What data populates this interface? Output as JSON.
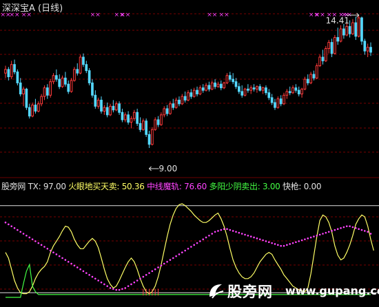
{
  "header": {
    "title": "深深宝A (日线)"
  },
  "indicator_bar": {
    "name": "股旁网",
    "items": [
      {
        "label": "TX: ",
        "value": "97.00",
        "color": "#e0e0e0"
      },
      {
        "label": "火眼地买天卖: ",
        "value": "50.36",
        "color": "#ffff66"
      },
      {
        "label": "中线魔轨: ",
        "value": "76.60",
        "color": "#ff44ff"
      },
      {
        "label": "多阳少阴卖出: ",
        "value": "3.00",
        "color": "#44ff44"
      },
      {
        "label": "快枪: ",
        "value": "0.00",
        "color": "#e0e0e0"
      }
    ]
  },
  "watermark": {
    "cn": "股旁网",
    "url": "www.gupang.com"
  },
  "chart_data": [
    {
      "type": "candlestick",
      "annotations": [
        {
          "text": "14.41",
          "kind": "high",
          "index": 118
        },
        {
          "text": "9.00",
          "kind": "low",
          "index": 48
        }
      ],
      "ohlc": [
        [
          12.05,
          12.35,
          11.85,
          12.2
        ],
        [
          12.2,
          12.3,
          11.75,
          11.9
        ],
        [
          11.9,
          12.55,
          11.8,
          12.4
        ],
        [
          12.4,
          12.6,
          12.0,
          12.1
        ],
        [
          12.1,
          12.2,
          11.55,
          11.65
        ],
        [
          11.65,
          11.85,
          11.1,
          11.2
        ],
        [
          11.2,
          11.5,
          10.7,
          11.4
        ],
        [
          11.4,
          11.45,
          10.55,
          10.65
        ],
        [
          10.65,
          10.8,
          10.2,
          10.3
        ],
        [
          10.3,
          10.85,
          10.25,
          10.75
        ],
        [
          10.75,
          11.0,
          10.4,
          10.5
        ],
        [
          10.5,
          10.9,
          10.45,
          10.8
        ],
        [
          10.8,
          11.2,
          10.7,
          11.1
        ],
        [
          11.1,
          11.55,
          10.95,
          11.45
        ],
        [
          11.45,
          11.6,
          11.0,
          11.15
        ],
        [
          11.15,
          11.8,
          11.05,
          11.7
        ],
        [
          11.7,
          12.05,
          11.6,
          11.95
        ],
        [
          11.95,
          12.2,
          11.7,
          11.8
        ],
        [
          11.8,
          12.0,
          11.4,
          11.5
        ],
        [
          11.5,
          11.95,
          11.45,
          11.85
        ],
        [
          11.85,
          12.1,
          11.5,
          11.6
        ],
        [
          11.6,
          11.75,
          11.2,
          11.3
        ],
        [
          11.3,
          11.85,
          11.25,
          11.75
        ],
        [
          11.75,
          12.3,
          11.7,
          12.2
        ],
        [
          12.2,
          12.45,
          11.95,
          12.05
        ],
        [
          12.05,
          12.8,
          12.0,
          12.7
        ],
        [
          12.7,
          12.85,
          12.3,
          12.4
        ],
        [
          12.4,
          12.55,
          12.05,
          12.15
        ],
        [
          12.15,
          12.25,
          11.55,
          11.65
        ],
        [
          11.65,
          11.8,
          11.05,
          11.15
        ],
        [
          11.15,
          11.35,
          10.6,
          10.7
        ],
        [
          10.7,
          11.05,
          10.6,
          10.95
        ],
        [
          10.95,
          11.1,
          10.4,
          10.5
        ],
        [
          10.5,
          10.75,
          10.35,
          10.65
        ],
        [
          10.65,
          10.85,
          10.25,
          10.35
        ],
        [
          10.35,
          10.8,
          10.3,
          10.7
        ],
        [
          10.7,
          10.95,
          10.45,
          10.55
        ],
        [
          10.55,
          10.9,
          10.5,
          10.8
        ],
        [
          10.8,
          10.9,
          10.35,
          10.45
        ],
        [
          10.45,
          10.6,
          10.05,
          10.15
        ],
        [
          10.15,
          10.45,
          10.05,
          10.35
        ],
        [
          10.35,
          10.5,
          9.95,
          10.05
        ],
        [
          10.05,
          10.3,
          9.8,
          10.2
        ],
        [
          10.2,
          10.55,
          10.1,
          10.45
        ],
        [
          10.45,
          10.6,
          9.9,
          10.0
        ],
        [
          10.0,
          10.25,
          9.65,
          9.75
        ],
        [
          9.75,
          10.2,
          9.7,
          10.1
        ],
        [
          10.1,
          10.2,
          9.45,
          9.55
        ],
        [
          9.55,
          9.7,
          9.0,
          9.15
        ],
        [
          9.15,
          9.85,
          9.1,
          9.75
        ],
        [
          9.75,
          10.25,
          9.7,
          10.15
        ],
        [
          10.15,
          10.3,
          9.85,
          9.95
        ],
        [
          9.95,
          10.45,
          9.9,
          10.35
        ],
        [
          10.35,
          10.7,
          10.25,
          10.6
        ],
        [
          10.6,
          10.75,
          10.3,
          10.4
        ],
        [
          10.4,
          10.9,
          10.35,
          10.8
        ],
        [
          10.8,
          11.0,
          10.55,
          10.65
        ],
        [
          10.65,
          11.05,
          10.6,
          10.95
        ],
        [
          10.95,
          11.1,
          10.7,
          10.8
        ],
        [
          10.8,
          11.2,
          10.75,
          11.1
        ],
        [
          11.1,
          11.3,
          10.85,
          10.95
        ],
        [
          10.95,
          11.35,
          10.9,
          11.25
        ],
        [
          11.25,
          11.4,
          11.0,
          11.1
        ],
        [
          11.1,
          11.45,
          11.05,
          11.35
        ],
        [
          11.35,
          11.5,
          11.1,
          11.2
        ],
        [
          11.2,
          11.55,
          11.15,
          11.45
        ],
        [
          11.45,
          11.6,
          11.25,
          11.35
        ],
        [
          11.35,
          11.65,
          11.3,
          11.55
        ],
        [
          11.55,
          11.7,
          11.3,
          11.4
        ],
        [
          11.4,
          11.75,
          11.35,
          11.65
        ],
        [
          11.65,
          11.8,
          11.4,
          11.5
        ],
        [
          11.5,
          11.7,
          11.45,
          11.6
        ],
        [
          11.6,
          11.75,
          11.35,
          11.45
        ],
        [
          11.45,
          11.7,
          11.4,
          11.65
        ],
        [
          11.65,
          12.05,
          11.6,
          11.95
        ],
        [
          11.95,
          12.1,
          11.7,
          11.8
        ],
        [
          11.8,
          12.05,
          11.6,
          11.7
        ],
        [
          11.7,
          11.85,
          11.4,
          11.5
        ],
        [
          11.5,
          11.65,
          11.2,
          11.3
        ],
        [
          11.3,
          11.55,
          11.05,
          11.15
        ],
        [
          11.15,
          11.45,
          11.1,
          11.4
        ],
        [
          11.4,
          11.6,
          11.25,
          11.35
        ],
        [
          11.35,
          11.55,
          11.2,
          11.45
        ],
        [
          11.45,
          11.6,
          11.3,
          11.4
        ],
        [
          11.4,
          11.55,
          11.25,
          11.5
        ],
        [
          11.5,
          11.6,
          11.3,
          11.35
        ],
        [
          11.35,
          11.5,
          11.2,
          11.45
        ],
        [
          11.45,
          11.55,
          11.15,
          11.25
        ],
        [
          11.25,
          11.4,
          10.95,
          11.05
        ],
        [
          11.05,
          11.2,
          10.75,
          10.85
        ],
        [
          10.85,
          11.0,
          10.55,
          10.65
        ],
        [
          10.65,
          11.1,
          10.6,
          11.0
        ],
        [
          11.0,
          11.15,
          10.7,
          10.8
        ],
        [
          10.8,
          11.25,
          10.75,
          11.15
        ],
        [
          11.15,
          11.4,
          11.0,
          11.3
        ],
        [
          11.3,
          11.5,
          11.15,
          11.25
        ],
        [
          11.25,
          11.55,
          11.2,
          11.45
        ],
        [
          11.45,
          11.6,
          11.25,
          11.35
        ],
        [
          11.35,
          11.5,
          11.1,
          11.2
        ],
        [
          11.2,
          11.45,
          11.05,
          11.4
        ],
        [
          11.4,
          11.9,
          11.35,
          11.8
        ],
        [
          11.8,
          12.0,
          11.55,
          11.65
        ],
        [
          11.65,
          12.1,
          11.6,
          12.0
        ],
        [
          12.0,
          12.15,
          11.75,
          11.85
        ],
        [
          11.85,
          12.45,
          11.8,
          12.35
        ],
        [
          12.35,
          12.8,
          12.3,
          12.7
        ],
        [
          12.7,
          13.0,
          12.4,
          12.55
        ],
        [
          12.55,
          13.15,
          12.5,
          13.05
        ],
        [
          13.05,
          13.4,
          12.85,
          13.3
        ],
        [
          13.3,
          13.45,
          12.7,
          12.85
        ],
        [
          12.85,
          13.6,
          12.8,
          13.5
        ],
        [
          13.5,
          13.9,
          13.2,
          13.35
        ],
        [
          13.35,
          14.0,
          13.3,
          13.85
        ],
        [
          13.85,
          14.05,
          13.45,
          13.6
        ],
        [
          13.6,
          14.1,
          13.55,
          13.95
        ],
        [
          13.95,
          14.2,
          13.5,
          13.65
        ],
        [
          13.65,
          14.25,
          13.6,
          14.1
        ],
        [
          14.1,
          14.35,
          13.4,
          13.55
        ],
        [
          13.55,
          14.41,
          13.5,
          14.3
        ],
        [
          14.3,
          14.35,
          13.2,
          13.35
        ],
        [
          13.35,
          13.45,
          12.8,
          12.95
        ],
        [
          12.95,
          13.25,
          12.7,
          13.1
        ],
        [
          13.1,
          13.3,
          12.75,
          12.9
        ]
      ],
      "signal_marks": [
        0,
        3,
        7,
        30,
        38,
        40,
        69,
        73,
        103,
        105,
        109,
        113,
        114
      ]
    },
    {
      "type": "line",
      "y_range": [
        0,
        100
      ],
      "reference_levels": [
        98,
        5
      ],
      "series": [
        {
          "name": "火眼地买天卖",
          "color": "#ffff66",
          "values": [
            48,
            42,
            30,
            18,
            10,
            5,
            4,
            4,
            6,
            12,
            20,
            26,
            30,
            33,
            38,
            48,
            55,
            60,
            65,
            71,
            76,
            75,
            70,
            62,
            56,
            52,
            52,
            56,
            60,
            63,
            60,
            53,
            42,
            30,
            20,
            14,
            10,
            12,
            18,
            25,
            32,
            38,
            42,
            38,
            30,
            20,
            12,
            6,
            4,
            6,
            12,
            22,
            35,
            50,
            65,
            78,
            88,
            95,
            99,
            100,
            98,
            95,
            92,
            88,
            85,
            82,
            80,
            80,
            82,
            85,
            88,
            90,
            84,
            76,
            65,
            52,
            40,
            32,
            26,
            22,
            20,
            20,
            22,
            26,
            32,
            38,
            42,
            46,
            48,
            46,
            40,
            35,
            30,
            24,
            20,
            16,
            12,
            10,
            8,
            7,
            6,
            10,
            25,
            45,
            65,
            82,
            88,
            86,
            80,
            70,
            55,
            45,
            40,
            42,
            48,
            56,
            66,
            78,
            84,
            88,
            86,
            76,
            62,
            50
          ]
        },
        {
          "name": "中线魔轨",
          "color": "#ff44ff",
          "dotted": true,
          "values": [
            80,
            78,
            76,
            74,
            72,
            70,
            68,
            66,
            64,
            62,
            60,
            58,
            56,
            54,
            52,
            50,
            48,
            46,
            44,
            42,
            40,
            38,
            36,
            34,
            32,
            30,
            28,
            26,
            24,
            22,
            20,
            18,
            16,
            14,
            12,
            10,
            9,
            8,
            8,
            9,
            10,
            12,
            14,
            16,
            18,
            20,
            22,
            24,
            26,
            28,
            30,
            32,
            34,
            36,
            38,
            40,
            42,
            44,
            46,
            48,
            50,
            52,
            54,
            56,
            58,
            60,
            62,
            64,
            66,
            68,
            70,
            71,
            72,
            73,
            73,
            72,
            71,
            70,
            69,
            68,
            67,
            66,
            65,
            64,
            63,
            62,
            61,
            60,
            59,
            58,
            57,
            56,
            55,
            55,
            56,
            57,
            58,
            59,
            60,
            61,
            62,
            63,
            64,
            65,
            66,
            67,
            68,
            69,
            70,
            71,
            72,
            73,
            74,
            75,
            76,
            76,
            75,
            74,
            73,
            72,
            71,
            70,
            68
          ]
        },
        {
          "name": "多阳少阴卖出",
          "color": "#44ff44",
          "values": [
            0,
            0,
            0,
            0,
            0,
            0,
            15,
            28,
            35,
            12,
            6,
            3,
            3,
            3,
            3,
            3,
            3,
            3,
            3,
            3,
            3,
            3,
            3,
            3,
            3,
            3,
            3,
            3,
            3,
            3,
            3,
            3,
            3,
            3,
            3,
            3,
            3,
            3,
            3,
            3,
            3,
            3,
            3,
            3,
            3,
            3,
            3,
            3,
            3,
            3,
            3,
            3,
            3,
            3,
            3,
            3,
            3,
            3,
            3,
            3,
            3,
            3,
            3,
            3,
            3,
            3,
            3,
            3,
            3,
            3,
            3,
            3,
            3,
            3,
            3,
            3,
            3,
            3,
            3,
            3,
            3,
            3,
            3,
            3,
            3,
            3,
            3,
            3,
            3,
            3,
            3,
            3,
            3,
            3,
            3,
            3,
            3,
            3,
            3,
            3,
            3,
            3,
            3,
            3,
            3,
            3,
            3,
            3,
            3,
            3,
            3,
            3,
            3,
            3,
            3,
            3,
            3,
            3,
            3,
            3,
            3,
            3,
            3
          ]
        }
      ]
    }
  ]
}
